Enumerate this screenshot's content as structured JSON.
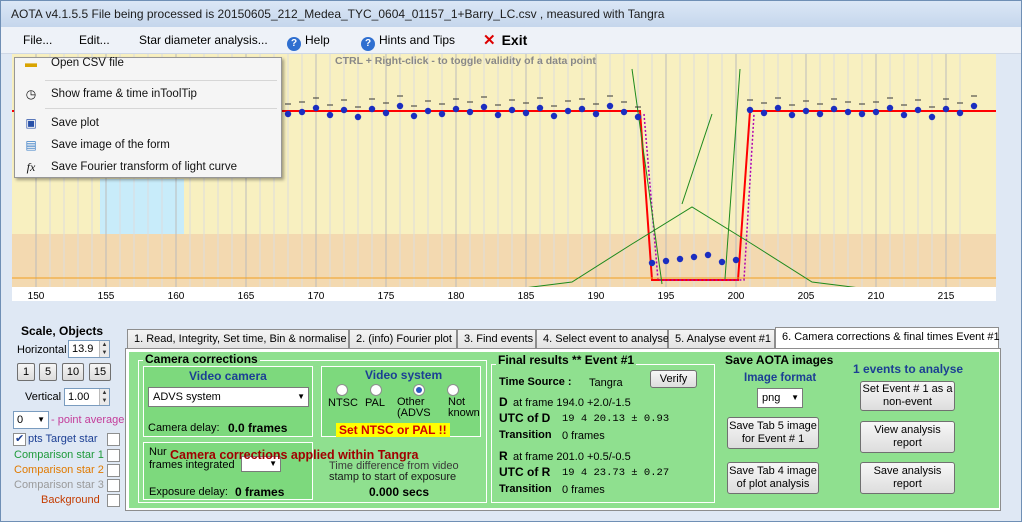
{
  "window": {
    "title": "AOTA v4.1.5.5    File being processed is  20150605_212_Medea_TYC_0604_01157_1+Barry_LC.csv ,  measured with Tangra"
  },
  "menu": {
    "file": "File...",
    "edit": "Edit...",
    "star_diameter": "Star diameter analysis...",
    "help": "Help",
    "hints": "Hints and Tips",
    "exit": "Exit"
  },
  "plot_hint": "CTRL + Right-click   -   to toggle validity of a data point",
  "context_menu": {
    "items": [
      {
        "label": "Open CSV file",
        "icon": "folder-open-icon"
      },
      {
        "label": "Show frame & time inToolTip",
        "icon": "clock-icon"
      },
      {
        "label": "Save plot",
        "icon": "floppy-disk-icon"
      },
      {
        "label": "Save image of the form",
        "icon": "image-icon"
      },
      {
        "label": "Save Fourier transform of light curve",
        "icon": "function-fx-icon"
      }
    ]
  },
  "chart_data": {
    "type": "scatter",
    "x_ticks": [
      "150",
      "155",
      "160",
      "165",
      "170",
      "175",
      "180",
      "185",
      "190",
      "195",
      "200",
      "205",
      "210",
      "215"
    ],
    "xlim": [
      149,
      218
    ],
    "event_model": {
      "D_frame": 194.0,
      "R_frame": 201.0
    },
    "colors": {
      "plot_bg_top": "#f8f0c0",
      "plot_bg_bottom": "#f3d9b0",
      "baseline": "#ff0000",
      "data_points": "#1b2ec0",
      "model_dotted": "#b000b0",
      "noise_line": "#1d8a1d",
      "camera_band": "#c8ecfa"
    }
  },
  "left_panel": {
    "scale_label": "Scale,  Objects",
    "horizontal_label": "Horizontal",
    "horizontal_value": "13.9",
    "scale_buttons": [
      "1",
      "5",
      "10",
      "15"
    ],
    "vertical_label": "Vertical",
    "vertical_value": "1.00",
    "point_average_value": "0",
    "point_average_label": "- point average",
    "objects": [
      {
        "label": "pts  Target star",
        "color": "#1c3f94",
        "checked": true
      },
      {
        "label": "Comparison star 1",
        "color": "#1f9a3a",
        "checked": false
      },
      {
        "label": "Comparison star 2",
        "color": "#e07a00",
        "checked": false
      },
      {
        "label": "Comparison star 3",
        "color": "#9a9a9a",
        "checked": false
      },
      {
        "label": "Background",
        "color": "#c43c00",
        "checked": false
      }
    ]
  },
  "tabs": [
    "1. Read, Integrity, Set time, Bin & normalise",
    "2. (info)  Fourier plot",
    "3. Find events",
    "4. Select event to analyse",
    "5. Analyse event #1",
    "6. Camera corrections & final times Event #1"
  ],
  "camera": {
    "group_title": "Camera corrections",
    "video_camera_title": "Video camera",
    "camera_value": "ADVS system",
    "camera_delay_label": "Camera delay:",
    "camera_delay_value": "0.0 frames",
    "video_system_title": "Video system",
    "video_options": [
      "NTSC",
      "PAL",
      "Other (ADVS",
      "Not known"
    ],
    "set_ntsc_warning": "Set NTSC or PAL !!",
    "frames_integrated_label_1": "Nur",
    "frames_integrated_label_2": "frames integrated",
    "overlay_banner": "Camera corrections applied within Tangra",
    "time_diff_text_1": "Time difference from video",
    "time_diff_text_2": "stamp to start of exposure",
    "time_diff_value": "0.000 secs",
    "exposure_delay_label": "Exposure delay:",
    "exposure_delay_value": "0 frames"
  },
  "final_results": {
    "title": "Final results  **  Event #1",
    "time_source_label": "Time Source :",
    "time_source_value": "Tangra",
    "verify_button": "Verify",
    "d_label": "D",
    "d_frame": "at frame 194.0  +2.0/-1.5",
    "utc_d_label": "UTC of D",
    "utc_d_value": "19  4 20.13 ± 0.93",
    "transition_label": "Transition",
    "transition_d_value": "0 frames",
    "r_label": "R",
    "r_frame": "at frame 201.0  +0.5/-0.5",
    "utc_r_label": "UTC of R",
    "utc_r_value": "19  4 23.73 ± 0.27",
    "transition_r_value": "0 frames"
  },
  "save_images": {
    "title": "Save AOTA images",
    "format_label": "Image format",
    "format_value": "png",
    "save_tab5": "Save Tab 5 image for Event # 1",
    "save_tab4": "Save Tab 4 image of plot analysis"
  },
  "events": {
    "title": "1 events to analyse",
    "set_nonevent": "Set Event # 1 as a non-event",
    "view_report": "View analysis report",
    "save_report": "Save analysis report"
  }
}
